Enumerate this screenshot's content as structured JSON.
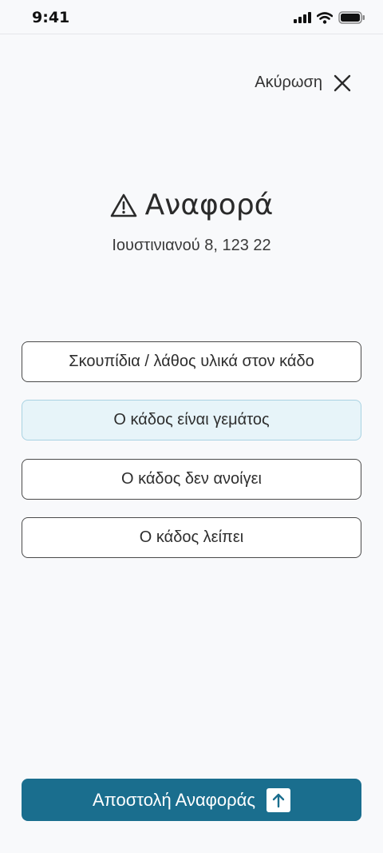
{
  "status_bar": {
    "time": "9:41"
  },
  "header": {
    "cancel_label": "Ακύρωση"
  },
  "report": {
    "title": "Αναφορά",
    "address": "Ιουστινιανού 8, 123 22",
    "options": [
      {
        "label": "Σκουπίδια / λάθος υλικά στον κάδο",
        "selected": false
      },
      {
        "label": "Ο κάδος είναι γεμάτος",
        "selected": true
      },
      {
        "label": "Ο κάδος δεν ανοίγει",
        "selected": false
      },
      {
        "label": "Ο κάδος λείπει",
        "selected": false
      }
    ],
    "submit_label": "Αποστολή Αναφοράς"
  },
  "colors": {
    "accent": "#1a6e8e",
    "selected_bg": "#e7f4f9",
    "selected_border": "#a9d2e2"
  },
  "icons": [
    "signal-icon",
    "wifi-icon",
    "battery-icon",
    "close-icon",
    "warning-icon",
    "upload-icon"
  ]
}
